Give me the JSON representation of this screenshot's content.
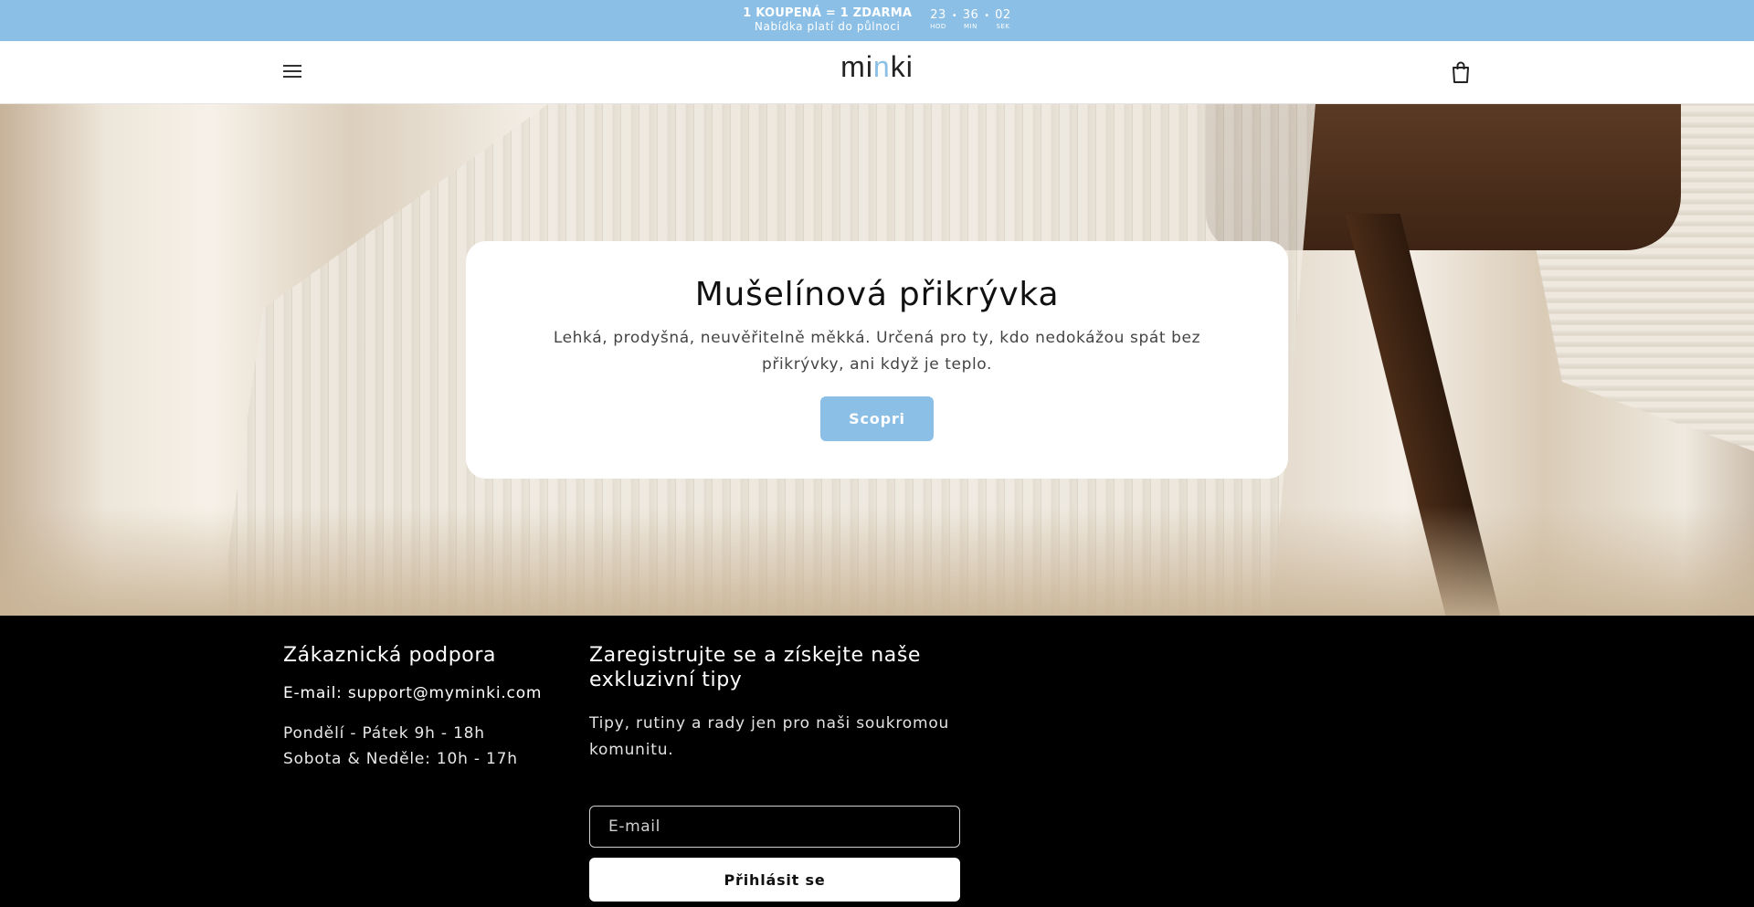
{
  "announcement": {
    "promo_title": "1 KOUPENÁ = 1 ZDARMA",
    "promo_subtitle": "Nabídka platí do půlnoci",
    "countdown": [
      {
        "value": "23",
        "label": "HOD"
      },
      {
        "value": "36",
        "label": "MIN"
      },
      {
        "value": "02",
        "label": "SEK"
      }
    ],
    "background_color": "#8bbfe6"
  },
  "header": {
    "logo_prefix": "mi",
    "logo_accent": "n",
    "logo_suffix": "ki",
    "menu_icon": "hamburger-menu-icon",
    "cart_icon": "shopping-bag-icon"
  },
  "hero": {
    "title": "Mušelínová přikrývka",
    "text": "Lehká, prodyšná, neuvěřitelně měkká. Určená pro ty, kdo nedokážou spát bez přikrývky, ani když je teplo.",
    "cta_label": "Scopri",
    "accent_color": "#8bbfe6"
  },
  "footer": {
    "support": {
      "heading": "Zákaznická podpora",
      "email": "E-mail: support@myminki.com",
      "hours_weekdays": "Pondělí - Pátek 9h - 18h",
      "hours_weekend": "Sobota & Neděle: 10h - 17h"
    },
    "newsletter": {
      "heading": "Zaregistrujte se a získejte naše exkluzivní tipy",
      "description": "Tipy, rutiny a rady jen pro naši soukromou komunitu.",
      "email_placeholder": "E-mail",
      "subscribe_label": "Přihlásit se"
    }
  }
}
